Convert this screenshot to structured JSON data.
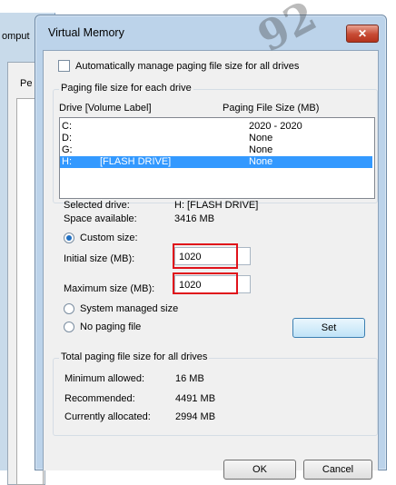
{
  "background": {
    "window_title": "omput",
    "tab_text": "Pe"
  },
  "watermark": "92",
  "dialog": {
    "title": "Virtual Memory",
    "auto_manage_label": "Automatically manage paging file size for all drives",
    "paging_group_label": "Paging file size for each drive",
    "col_drive": "Drive  [Volume Label]",
    "col_size": "Paging File Size (MB)",
    "drives": [
      {
        "drive": "C:",
        "label": "",
        "size": "2020 - 2020",
        "selected": false
      },
      {
        "drive": "D:",
        "label": "",
        "size": "None",
        "selected": false
      },
      {
        "drive": "G:",
        "label": "",
        "size": "None",
        "selected": false
      },
      {
        "drive": "H:",
        "label": "[FLASH DRIVE]",
        "size": "None",
        "selected": true
      }
    ],
    "selected_drive_label": "Selected drive:",
    "selected_drive_value": "H:  [FLASH DRIVE]",
    "space_available_label": "Space available:",
    "space_available_value": "3416 MB",
    "custom_size_label": "Custom size:",
    "initial_size_label": "Initial size (MB):",
    "initial_size_value": "1020",
    "maximum_size_label": "Maximum size (MB):",
    "maximum_size_value": "1020",
    "system_managed_label": "System managed size",
    "no_paging_label": "No paging file",
    "set_button": "Set",
    "total_group_label": "Total paging file size for all drives",
    "minimum_label": "Minimum allowed:",
    "minimum_value": "16 MB",
    "recommended_label": "Recommended:",
    "recommended_value": "4491 MB",
    "allocated_label": "Currently allocated:",
    "allocated_value": "2994 MB",
    "ok_button": "OK",
    "cancel_button": "Cancel"
  }
}
